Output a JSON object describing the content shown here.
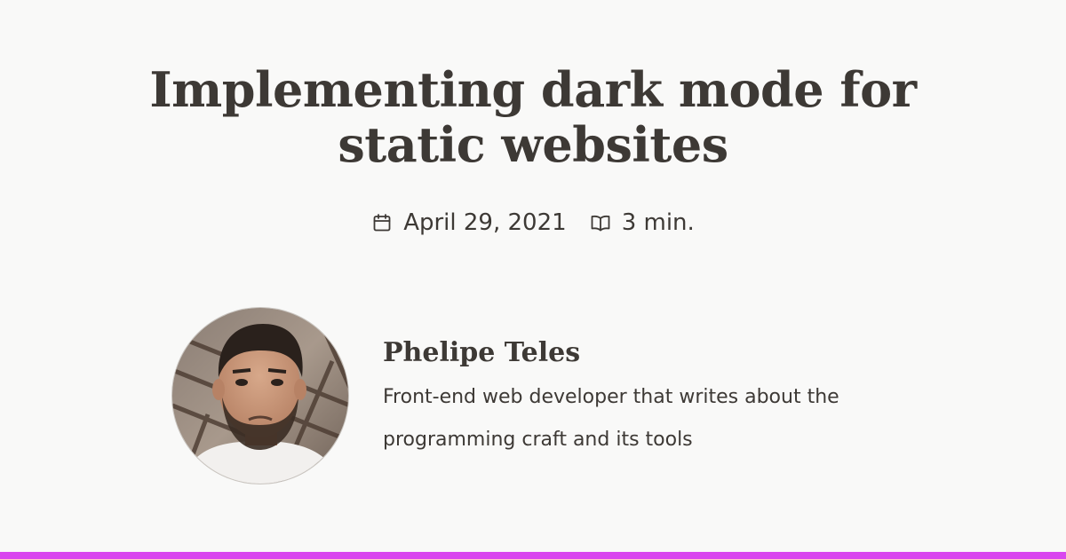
{
  "post": {
    "title": "Implementing dark mode for static websites",
    "date": "April 29, 2021",
    "reading_time": "3 min."
  },
  "author": {
    "name": "Phelipe Teles",
    "bio": "Front-end web developer that writes about the programming craft and its tools"
  },
  "icons": {
    "date": "calendar-icon",
    "reading_time": "open-book-icon"
  },
  "colors": {
    "background": "#f9f9f8",
    "text": "#3d3935",
    "accent": "#d946ef"
  }
}
